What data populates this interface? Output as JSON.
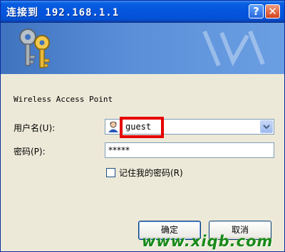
{
  "window": {
    "title": "连接到 192.168.1.1"
  },
  "titlebar_buttons": {
    "help": "?",
    "close": "✕"
  },
  "dialog": {
    "site_text": "Wireless Access Point",
    "username": {
      "label": "用户名(U):",
      "value": "guest"
    },
    "password": {
      "label": "密码(P):",
      "value": "*****"
    },
    "remember": {
      "label": "记住我的密码(R)",
      "checked": false
    }
  },
  "buttons": {
    "ok": "确定",
    "cancel": "取消"
  },
  "watermark": "www.xiqb.com",
  "colors": {
    "title_bar": "#0454de",
    "highlight": "#e60000",
    "watermark": "#1a8a1a"
  }
}
